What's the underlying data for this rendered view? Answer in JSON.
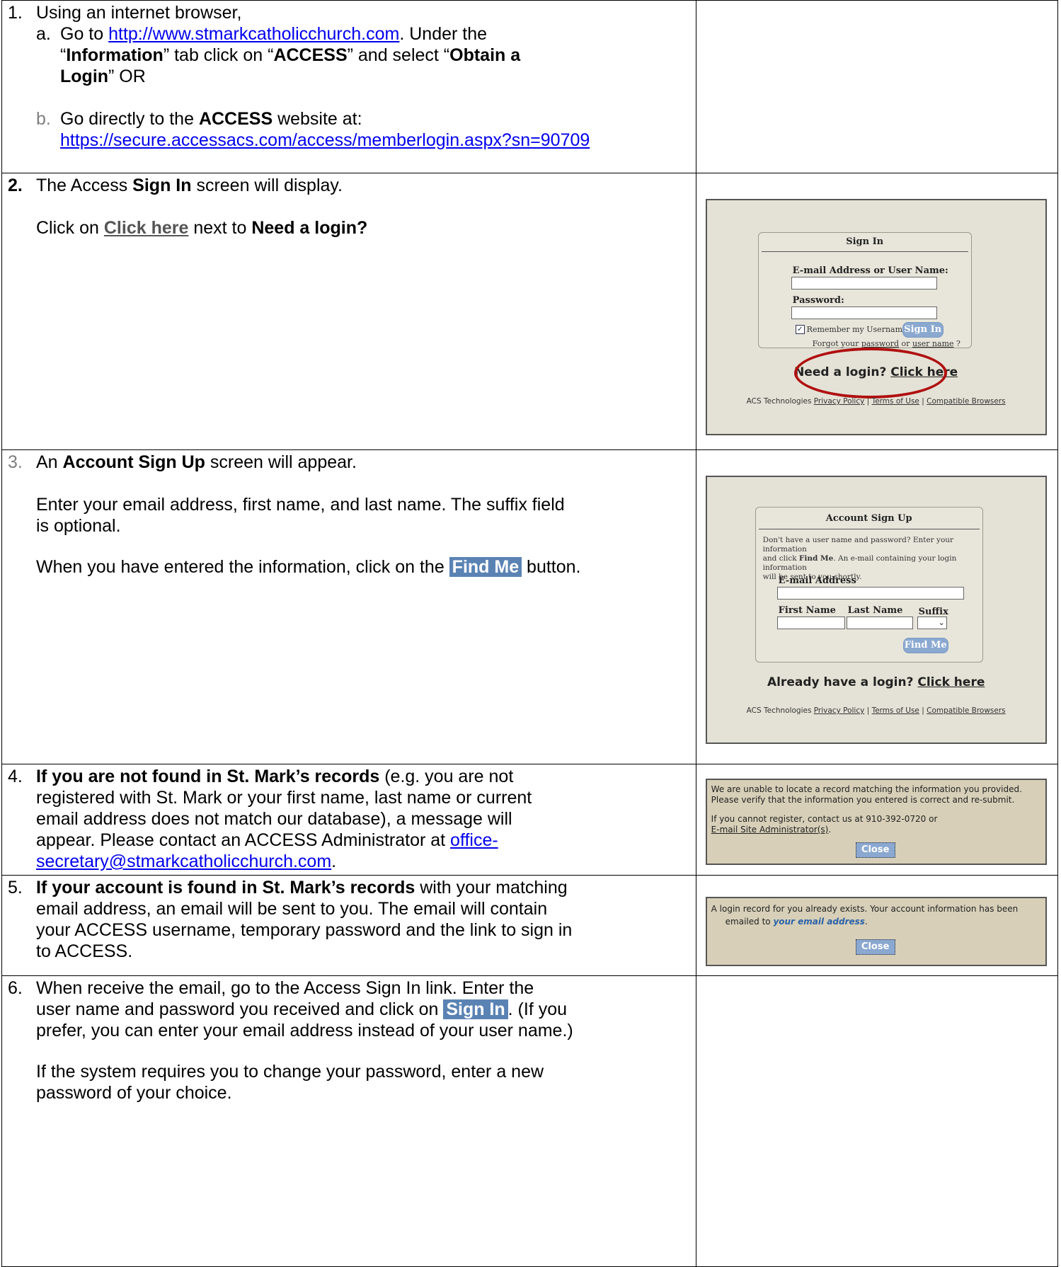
{
  "step1": {
    "num": "1.",
    "intro": "Using an internet browser,",
    "a_letter": "a.",
    "a_pre": "Go to ",
    "a_link": "http://www.stmarkcatholicchurch.com",
    "a_mid": ".  Under the",
    "a_q1": "“",
    "a_info": "Information",
    "a_tab": "” tab click on “",
    "a_access": "ACCESS",
    "a_select": "” and select “",
    "a_obtain1": "Obtain a",
    "a_obtain2": "Login",
    "a_or": "”   OR",
    "b_letter": "b.",
    "b_pre": "Go directly to the ",
    "b_access": "ACCESS",
    "b_post": " website at:",
    "b_link": "https://secure.accessacs.com/access/memberlogin.aspx?sn=90709"
  },
  "step2": {
    "num": "2.",
    "l1_pre": "The Access ",
    "l1_b": "Sign In",
    "l1_post": " screen will display.",
    "l2_pre": "Click on ",
    "l2_link": "Click here",
    "l2_mid": " next to ",
    "l2_b": "Need a login?"
  },
  "step3": {
    "num": "3.",
    "l1_pre": "An ",
    "l1_b": "Account Sign Up",
    "l1_post": " screen will appear.",
    "l2a": "Enter your email address, first name, and last name.  The suffix field",
    "l2b": "is optional.",
    "l3_pre": "When you have entered the information, click on the ",
    "l3_btn": "Find Me",
    "l3_post": " button."
  },
  "step4": {
    "num": "4.",
    "b": "If you are not found in St. Mark’s records",
    "l1_post": " (e.g. you are not",
    "l2": "registered with St. Mark or your first name, last name or current",
    "l3": "email address does not match our database), a message will",
    "l4": "appear. Please contact an ACCESS Administrator at ",
    "link1": "office-",
    "link2": "secretary@stmarkcatholicchurch.com",
    "end": "."
  },
  "step5": {
    "num": "5.",
    "b": "If your account is found in St. Mark’s records",
    "l1_post": " with your matching",
    "l2": "email address, an email will be sent to you.  The email will contain",
    "l3": "your ACCESS username, temporary password and the link to sign in",
    "l4": "to ACCESS."
  },
  "step6": {
    "num": "6.",
    "l1": "When receive the email, go to the Access Sign In link.  Enter the",
    "l2_pre": "user name and password you received and click on ",
    "l2_btn": "Sign In",
    "l2_post": ".  (If you",
    "l3": "prefer, you can enter your email address instead of your user name.)",
    "l4": "If the system requires you to change your password, enter a new",
    "l5": "password of your choice."
  },
  "signin_shot": {
    "title": "Sign In",
    "email_label": "E-mail Address or User Name:",
    "password_label": "Password:",
    "remember": "Remember my Username",
    "signin_btn": "Sign In",
    "forgot_pre": "Forgot your ",
    "forgot_password": "password",
    "forgot_or": " or ",
    "forgot_user": "user name",
    "forgot_post": " ?",
    "need_pre": "Need a login? ",
    "need_link": "Click here",
    "footer_pre": "ACS Technologies ",
    "footer_privacy": "Privacy Policy",
    "footer_terms": "Terms of Use",
    "footer_compat": "Compatible Browsers",
    "highlight_color": "#b01010"
  },
  "signup_shot": {
    "title": "Account Sign Up",
    "desc1": "Don't have a user name and password? Enter your information",
    "desc2_pre": "and click ",
    "desc2_b": "Find Me",
    "desc2_post": ". An e-mail containing your login information",
    "desc3": "will be sent to you shortly.",
    "email_label": "E-mail Address",
    "first_label": "First Name",
    "last_label": "Last Name",
    "suffix_label": "Suffix",
    "findme_btn": "Find Me",
    "already_pre": "Already have a login? ",
    "already_link": "Click here",
    "footer_pre": "ACS Technologies ",
    "footer_privacy": "Privacy Policy",
    "footer_terms": "Terms of Use",
    "footer_compat": "Compatible Browsers"
  },
  "notfound_msg": {
    "l1": "We are unable to locate a record matching the information you provided.",
    "l2": "Please verify that the information you entered is correct and re-submit.",
    "l3": "If you cannot register, contact us at 910-392-0720 or",
    "l4": "E-mail Site Administrator(s)",
    "l4_end": ".",
    "close": "Close"
  },
  "found_msg": {
    "l1": "A login record for you already exists. Your account information has been",
    "l2_pre": "emailed to ",
    "l2_link": "your email address",
    "l2_end": ".",
    "close": "Close"
  }
}
